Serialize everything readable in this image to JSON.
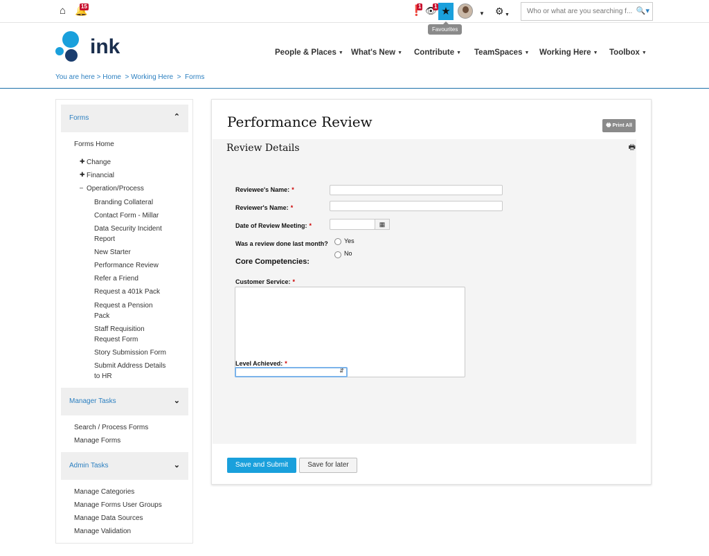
{
  "topbar": {
    "notifications_count": "15",
    "alerts_count": "1",
    "watch_count": "1",
    "tooltip": "Favourites",
    "search_placeholder": "Who or what are you searching f..."
  },
  "header": {
    "logo_text": "ink",
    "nav": [
      "People & Places",
      "What's New",
      "Contribute",
      "TeamSpaces",
      "Working Here",
      "Toolbox"
    ],
    "breadcrumb": "You are here > Home  > Working Here  >  Forms"
  },
  "sidebar": {
    "forms_header": "Forms",
    "forms_home": "Forms Home",
    "categories": [
      "Change",
      "Financial",
      "Operation/Process"
    ],
    "forms": [
      "Branding Collateral",
      "Contact Form - Millar",
      "Data Security Incident",
      "Report",
      "New Starter",
      "Performance Review",
      "Refer a Friend",
      "Request a 401k Pack",
      "Request a Pension",
      "Pack",
      "Staff Requisition",
      "Request Form",
      "Story Submission Form",
      "Submit Address Details",
      "to HR"
    ],
    "manager_header": "Manager Tasks",
    "manager_items": [
      "Search / Process Forms",
      "Manage Forms"
    ],
    "admin_header": "Admin Tasks",
    "admin_items": [
      "Manage Categories",
      "Manage Forms User Groups",
      "Manage Data Sources",
      "Manage Validation"
    ]
  },
  "form": {
    "title": "Performance Review",
    "print_all": "Print All",
    "section_title": "Review Details",
    "reviewee_label": "Reviewee's Name:",
    "reviewer_label": "Reviewer's Name:",
    "date_label": "Date of Review Meeting:",
    "review_last_month_label": "Was a review done last month?",
    "option_yes": "Yes",
    "option_no": "No",
    "core_competencies": "Core Competencies:",
    "customer_service_label": "Customer Service:",
    "level_label": "Level Achieved:",
    "required_mark": "*",
    "submit_label": "Save and Submit",
    "later_label": "Save for later"
  }
}
